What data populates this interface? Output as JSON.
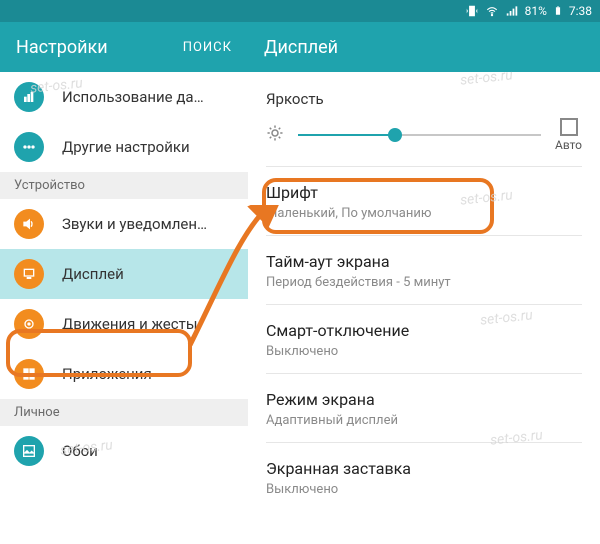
{
  "statusbar": {
    "battery": "81%",
    "time": "7:38"
  },
  "left_header": {
    "title": "Настройки",
    "search": "ПОИСК"
  },
  "right_header": {
    "title": "Дисплей"
  },
  "categories": {
    "device": "Устройство",
    "personal": "Личное"
  },
  "sidebar": [
    {
      "label": "Использование да…"
    },
    {
      "label": "Другие настройки"
    },
    {
      "label": "Звуки и уведомлен…"
    },
    {
      "label": "Дисплей"
    },
    {
      "label": "Движения и жесты"
    },
    {
      "label": "Приложения"
    },
    {
      "label": "Обои"
    }
  ],
  "brightness": {
    "label": "Яркость",
    "auto": "Авто"
  },
  "rows": [
    {
      "title": "Шрифт",
      "sub": "Маленький, По умолчанию"
    },
    {
      "title": "Тайм-аут экрана",
      "sub": "Период бездействия - 5 минут"
    },
    {
      "title": "Смарт-отключение",
      "sub": "Выключено"
    },
    {
      "title": "Режим экрана",
      "sub": "Адаптивный дисплей"
    },
    {
      "title": "Экранная заставка",
      "sub": "Выключено"
    }
  ],
  "watermark": "set-os.ru"
}
